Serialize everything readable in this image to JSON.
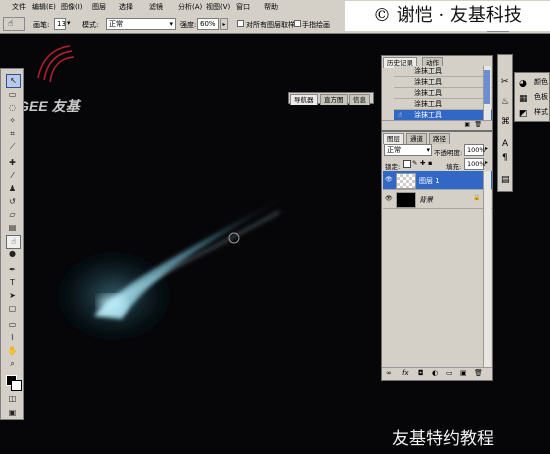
{
  "watermark_top": "© 谢恺 · 友基科技",
  "watermark_bottom": "友基特约教程",
  "logo_text": "UGEE 友基",
  "menu": [
    "文件",
    "编辑(E)",
    "图像(I)",
    "图层",
    "选择",
    "滤镜",
    "分析(A)",
    "视图(V)",
    "窗口",
    "帮助"
  ],
  "options": {
    "brush_label": "画笔:",
    "brush_size": "13",
    "mode_label": "模式:",
    "mode_value": "正常",
    "strength_label": "强度:",
    "strength_value": "60%",
    "sample_all_label": "对所有图层取样",
    "finger_paint_label": "手指绘画"
  },
  "navigator_tabs": [
    "导航器",
    "直方图",
    "信息"
  ],
  "history": {
    "tabs": [
      "历史记录",
      "动作"
    ],
    "items": [
      "涂抹工具",
      "涂抹工具",
      "涂抹工具",
      "涂抹工具",
      "涂抹工具"
    ],
    "selected_index": 4
  },
  "layers": {
    "tabs": [
      "图层",
      "通道",
      "路径"
    ],
    "blend_mode": "正常",
    "opacity_label": "不透明度:",
    "opacity_value": "100%",
    "lock_label": "锁定:",
    "fill_label": "填充:",
    "fill_value": "100%",
    "items": [
      {
        "name": "图层 1",
        "selected": true
      },
      {
        "name": "背景",
        "selected": false
      }
    ]
  },
  "right_panel": {
    "buttons": [
      "颜色",
      "色板",
      "样式"
    ]
  },
  "colors": {
    "ui_gray": "#d4d0c8",
    "selection_blue": "#3167c5",
    "canvas_bg": "#060608",
    "streak": "#9fdcec"
  }
}
